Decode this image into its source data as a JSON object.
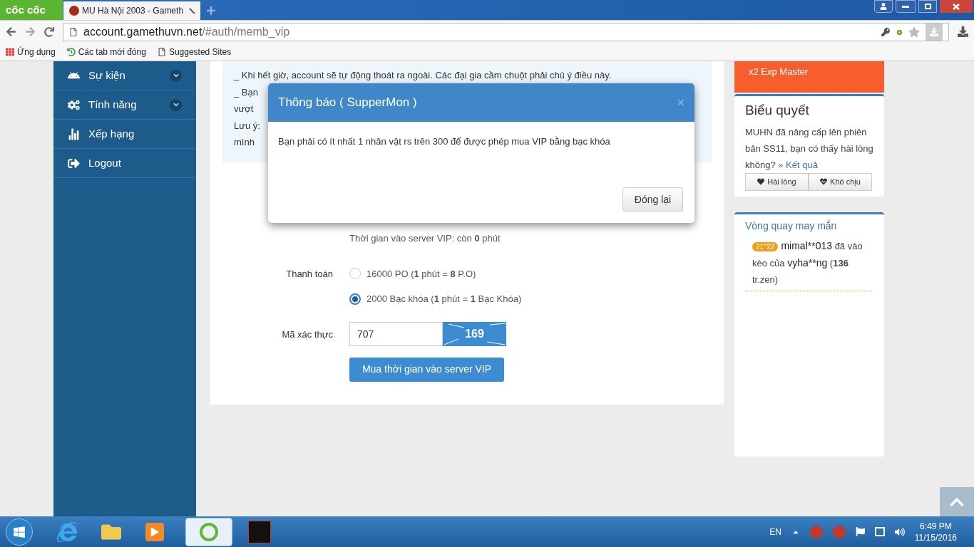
{
  "browser": {
    "brand": "cốc cốc",
    "tab_title": "MU Hà Nội 2003 - Gameth",
    "url_host": "account.gamethuvn.net",
    "url_path": "/#auth/memb_vip",
    "bookmarks": [
      "Ứng dụng",
      "Các tab mới đóng",
      "Suggested Sites"
    ]
  },
  "sidebar": {
    "items": [
      {
        "label": "Sự kiện",
        "expandable": true
      },
      {
        "label": "Tính năng",
        "expandable": true
      },
      {
        "label": "Xếp hạng",
        "expandable": false
      },
      {
        "label": "Logout",
        "expandable": false
      }
    ]
  },
  "notice": {
    "lines": [
      "_ Khi hết giờ, account sẽ tự động thoát ra ngoài. Các đại gia cầm chuột phải chú ý điều này.",
      "_ Bạn",
      "vượt",
      "Lưu ý:",
      "mình"
    ]
  },
  "form": {
    "remaining": "Thời gian vào server VIP: còn **0** phút",
    "payment_label": "Thanh toán",
    "payment_options": [
      {
        "label": "16000 PO (**1** phút = **8** P.O)",
        "selected": false
      },
      {
        "label": "2000 Bạc khóa (**1** phút = **1** Bạc Khóa)",
        "selected": true
      }
    ],
    "captcha_label": "Mã xác thực",
    "captcha_value": "707",
    "captcha_text": "169",
    "submit": "Mua thời gian vào server VIP"
  },
  "modal": {
    "title": "Thông báo ( SupperMon )",
    "close": "×",
    "message": "Bạn phải có ít nhất 1 nhân vật rs trên 300 để được phép mua VIP bằng bạc khóa",
    "button": "Đóng lại"
  },
  "promo": {
    "title": "x2 Exp Master"
  },
  "poll": {
    "title": "Biểu quyết",
    "question": "MUHN đã nâng cấp lên phiên bản SS11, bạn có thấy hài lòng không?",
    "result_link": "» Kết quả",
    "options": [
      "Hài lòng",
      "Khó chịu"
    ]
  },
  "lucky_wheel": {
    "title": "Vòng quay may mắn",
    "entries": [
      {
        "time": "21$^{h}$22",
        "user": "mimal**013",
        "action": "đã vào kèo của",
        "target": "vyha**ng",
        "amount": "(**136** tr.zen)"
      }
    ]
  },
  "taskbar": {
    "language": "EN",
    "time": "6:49 PM",
    "date": "11/15/2016"
  }
}
